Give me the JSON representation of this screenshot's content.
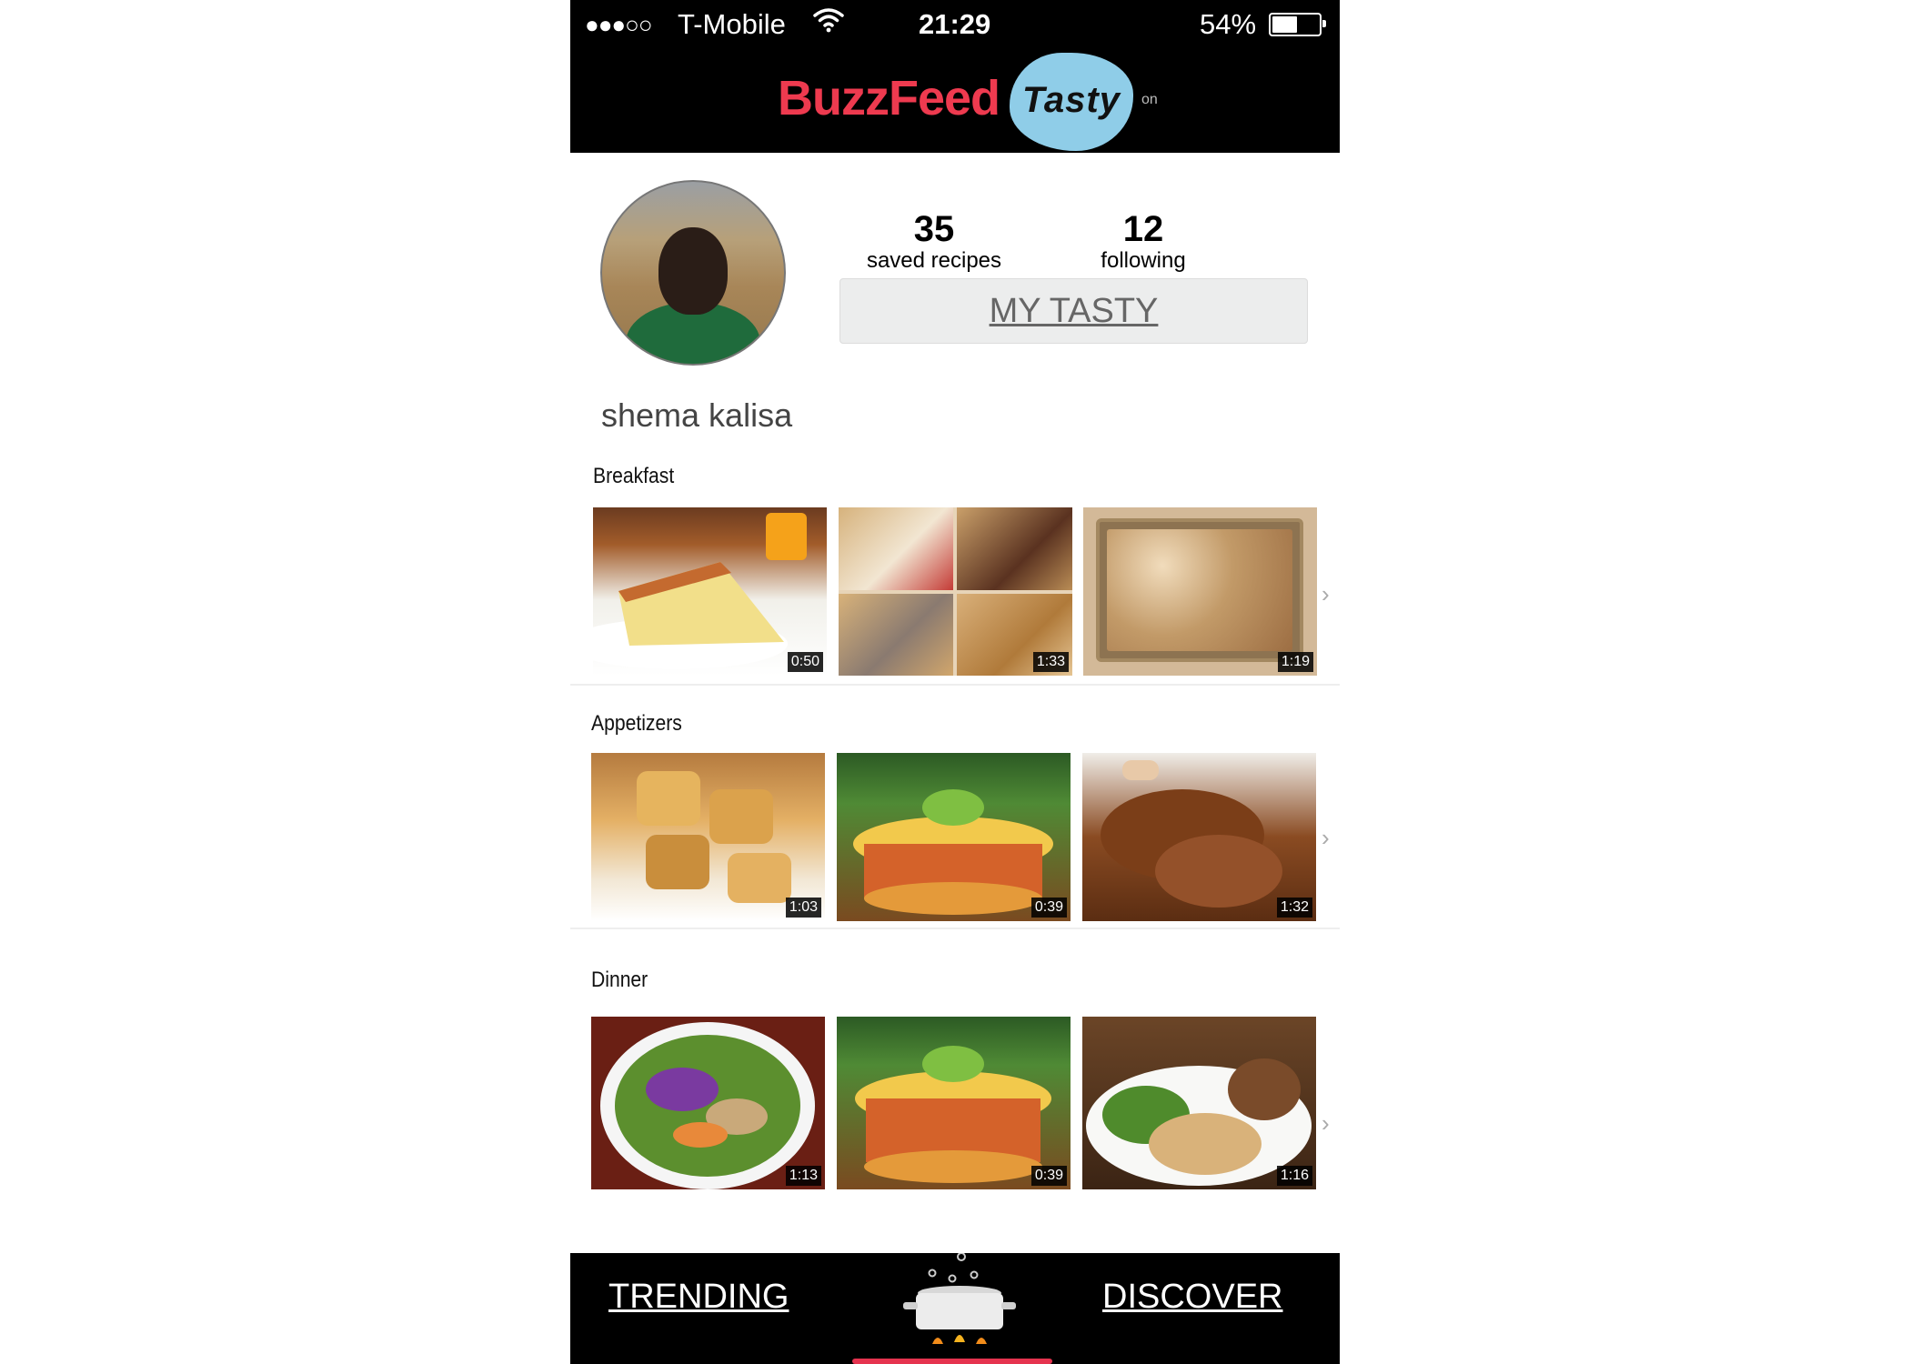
{
  "status_bar": {
    "signal": "●●●○○",
    "carrier": "T-Mobile",
    "time": "21:29",
    "battery": "54%",
    "battery_level": 0.54,
    "wifi_icon": "wifi-icon"
  },
  "header": {
    "brand": "BuzzFeed",
    "app": "Tasty",
    "on_text": "on",
    "colors": {
      "brand": "#ee3a4f",
      "badge": "#8fcde8",
      "bar": "#000000"
    }
  },
  "profile": {
    "name": "shema kalisa",
    "saved_count": "35",
    "saved_label": "saved recipes",
    "following_count": "12",
    "following_label": "following",
    "my_tasty_button": "MY TASTY"
  },
  "sections": [
    {
      "title": "Breakfast",
      "items": [
        {
          "name": "breakfast-quiche",
          "duration": "0:50"
        },
        {
          "name": "breakfast-sausage-rolls",
          "duration": "1:33"
        },
        {
          "name": "breakfast-granola-bars",
          "duration": "1:19"
        }
      ]
    },
    {
      "title": "Appetizers",
      "items": [
        {
          "name": "appetizer-tater-tots",
          "duration": "1:03"
        },
        {
          "name": "appetizer-tortilla-stack",
          "duration": "0:39"
        },
        {
          "name": "appetizer-fried-chicken",
          "duration": "1:32"
        }
      ]
    },
    {
      "title": "Dinner",
      "items": [
        {
          "name": "dinner-salad",
          "duration": "1:13"
        },
        {
          "name": "dinner-tortilla-stack",
          "duration": "0:39"
        },
        {
          "name": "dinner-roast-chicken",
          "duration": "1:16"
        }
      ]
    }
  ],
  "bottom_nav": {
    "left": "TRENDING",
    "right": "DISCOVER",
    "center_icon": "cooking-pot-icon"
  }
}
